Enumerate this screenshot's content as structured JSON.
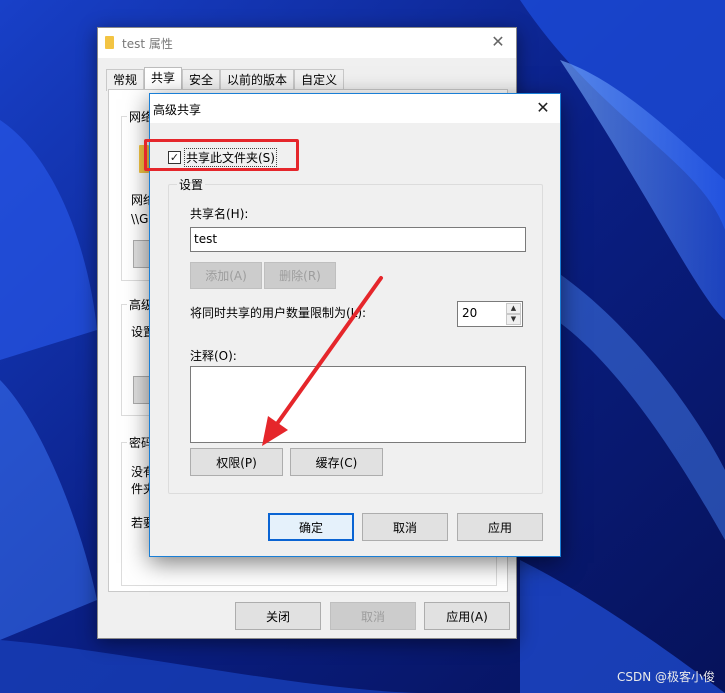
{
  "properties_window": {
    "title": "test 属性",
    "close_glyph": "✕",
    "tabs": [
      "常规",
      "共享",
      "安全",
      "以前的版本",
      "自定义"
    ],
    "active_tab": "共享",
    "hidden_fragments": {
      "network_group": "网络",
      "network_path_label": "网络",
      "network_path": "\\\\G",
      "advanced_group": "高级",
      "advanced_desc": "设置",
      "password_group": "密码",
      "password_desc_1": "没有",
      "password_desc_2": "件夹",
      "password_desc_3": "若要"
    },
    "buttons": {
      "close": "关闭",
      "cancel": "取消",
      "apply": "应用(A)"
    }
  },
  "dialog": {
    "title": "高级共享",
    "close_glyph": "✕",
    "share_checkbox": {
      "label": "共享此文件夹(S)",
      "checked": true,
      "check_glyph": "✓"
    },
    "settings_group": "设置",
    "share_name_label": "共享名(H):",
    "share_name_value": "test",
    "add_button": "添加(A)",
    "remove_button": "删除(R)",
    "user_limit_label": "将同时共享的用户数量限制为(L):",
    "user_limit_value": "20",
    "spin_up_glyph": "▲",
    "spin_down_glyph": "▼",
    "comment_label": "注释(O):",
    "permissions_button": "权限(P)",
    "cache_button": "缓存(C)",
    "ok_button": "确定",
    "cancel_button": "取消",
    "apply_button": "应用"
  },
  "watermark": "CSDN @极客小俊",
  "colors": {
    "highlight": "#e5262b",
    "arrow": "#e5262b",
    "accent": "#0a64d3",
    "wallpaper": "#0b1f8a"
  }
}
